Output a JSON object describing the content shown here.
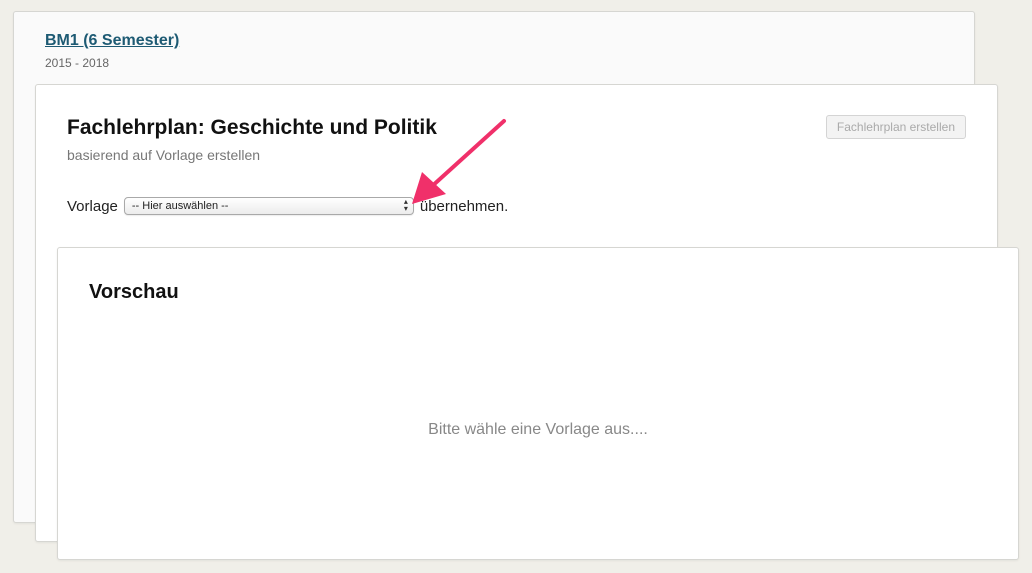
{
  "program": {
    "title": "BM1 (6 Semester)",
    "years": "2015 - 2018"
  },
  "plan": {
    "title": "Fachlehrplan: Geschichte und Politik",
    "subtitle": "basierend auf Vorlage erstellen",
    "create_button": "Fachlehrplan erstellen",
    "template_label": "Vorlage",
    "template_select_value": "-- Hier auswählen --",
    "template_suffix": "übernehmen."
  },
  "preview": {
    "title": "Vorschau",
    "empty_message": "Bitte wähle eine Vorlage aus...."
  },
  "colors": {
    "link": "#1d5a73",
    "annotation_arrow": "#f0306a",
    "background": "#f0efe9"
  },
  "icons": [
    "select-chevron-icon",
    "annotation-arrow-icon"
  ]
}
